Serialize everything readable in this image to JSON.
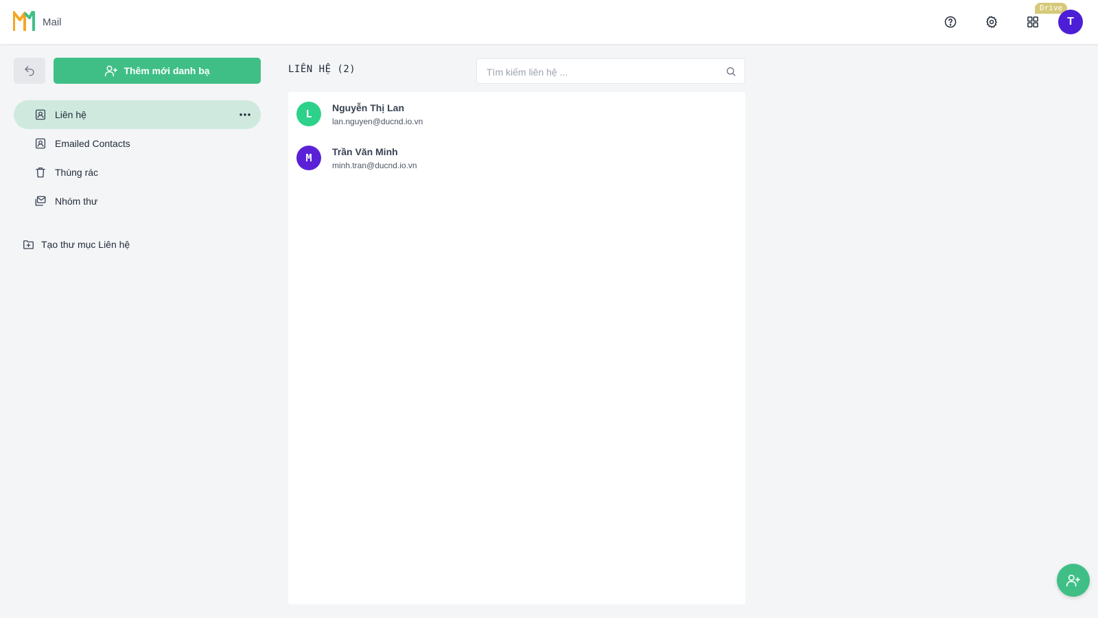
{
  "header": {
    "app_name": "Mail",
    "drive_badge": "Drive",
    "user_initial": "T",
    "icons": [
      "help-icon",
      "gear-icon",
      "apps-grid-icon"
    ]
  },
  "sidebar": {
    "add_button_label": "Thêm mới danh bạ",
    "items": [
      {
        "label": "Liên hệ",
        "icon": "contact-card-icon",
        "active": true
      },
      {
        "label": "Emailed Contacts",
        "icon": "contact-card-icon",
        "active": false
      },
      {
        "label": "Thùng rác",
        "icon": "trash-icon",
        "active": false
      },
      {
        "label": "Nhóm thư",
        "icon": "mail-group-icon",
        "active": false
      }
    ],
    "create_folder_label": "Tạo thư mục Liên hệ"
  },
  "contacts": {
    "title": "LIÊN HỆ (2)",
    "search_placeholder": "Tìm kiếm liên hệ ...",
    "items": [
      {
        "initial": "L",
        "name": "Nguyễn Thị Lan",
        "email": "lan.nguyen@ducnd.io.vn",
        "color": "#2ed18a"
      },
      {
        "initial": "M",
        "name": "Trần Văn Minh",
        "email": "minh.tran@ducnd.io.vn",
        "color": "#5b21d6"
      }
    ]
  },
  "colors": {
    "accent": "#3fbf86",
    "active_nav": "#cfe9df",
    "avatar": "#4c1fd6"
  }
}
